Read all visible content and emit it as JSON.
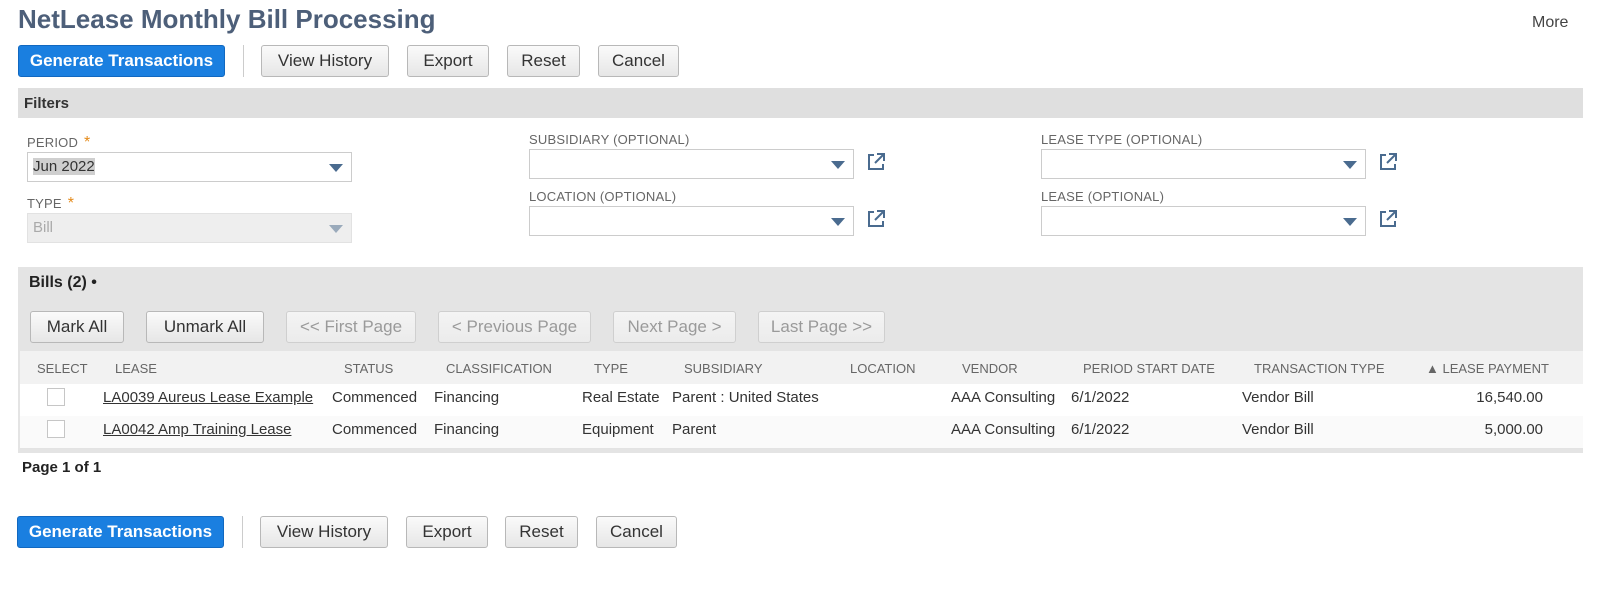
{
  "page": {
    "title": "NetLease Monthly Bill Processing",
    "more_label": "More"
  },
  "toolbar": {
    "generate_label": "Generate Transactions",
    "history_label": "View History",
    "export_label": "Export",
    "reset_label": "Reset",
    "cancel_label": "Cancel"
  },
  "filters": {
    "header": "Filters",
    "period": {
      "label": "PERIOD",
      "required_mark": "*",
      "value": "Jun 2022"
    },
    "type": {
      "label": "TYPE",
      "required_mark": "*",
      "value": "Bill"
    },
    "subsidiary": {
      "label": "SUBSIDIARY (OPTIONAL)",
      "value": ""
    },
    "location": {
      "label": "LOCATION (OPTIONAL)",
      "value": ""
    },
    "lease_type": {
      "label": "LEASE TYPE (OPTIONAL)",
      "value": ""
    },
    "lease": {
      "label": "LEASE (OPTIONAL)",
      "value": ""
    }
  },
  "bills": {
    "title": "Bills (2)",
    "title_mark": "•",
    "buttons": {
      "mark_all": "Mark All",
      "unmark_all": "Unmark All",
      "first_page": "<< First Page",
      "previous_page": "< Previous Page",
      "next_page": "Next Page >",
      "last_page": "Last Page >>"
    },
    "columns": [
      "SELECT",
      "LEASE",
      "STATUS",
      "CLASSIFICATION",
      "TYPE",
      "SUBSIDIARY",
      "LOCATION",
      "VENDOR",
      "PERIOD START DATE",
      "TRANSACTION TYPE",
      "▲ LEASE PAYMENT"
    ],
    "rows": [
      {
        "lease": "LA0039 Aureus Lease Example",
        "status": "Commenced",
        "classification": "Financing",
        "type": "Real Estate",
        "subsidiary": "Parent : United States",
        "location": "",
        "vendor": "AAA Consulting",
        "period_start": "6/1/2022",
        "transaction_type": "Vendor Bill",
        "payment": "16,540.00"
      },
      {
        "lease": "LA0042 Amp Training Lease",
        "status": "Commenced",
        "classification": "Financing",
        "type": "Equipment",
        "subsidiary": "Parent",
        "location": "",
        "vendor": "AAA Consulting",
        "period_start": "6/1/2022",
        "transaction_type": "Vendor Bill",
        "payment": "5,000.00"
      }
    ],
    "page_info": "Page 1 of 1"
  },
  "icons": {
    "dropdown": "caret-down-icon",
    "open_record": "external-link-icon"
  },
  "colors": {
    "primary_button": "#1a7fe0",
    "title": "#4d5f79",
    "required": "#e48a1a",
    "section_bar": "#dfdfdf"
  }
}
